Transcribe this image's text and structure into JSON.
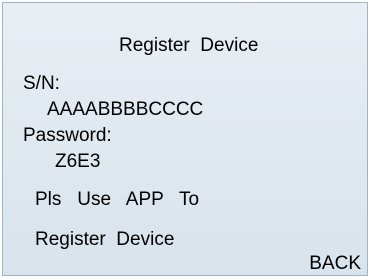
{
  "screen": {
    "title": "Register  Device",
    "sn_label": "S/N:",
    "sn_value": "AAAABBBBCCCC",
    "password_label": "Password:",
    "password_value": "Z6E3",
    "message_line1": "Pls   Use   APP   To",
    "message_line2": "Register  Device",
    "back_label": "BACK"
  },
  "colors": {
    "background": "#dfe7ef",
    "border": "#9db5c8",
    "text": "#000000"
  }
}
